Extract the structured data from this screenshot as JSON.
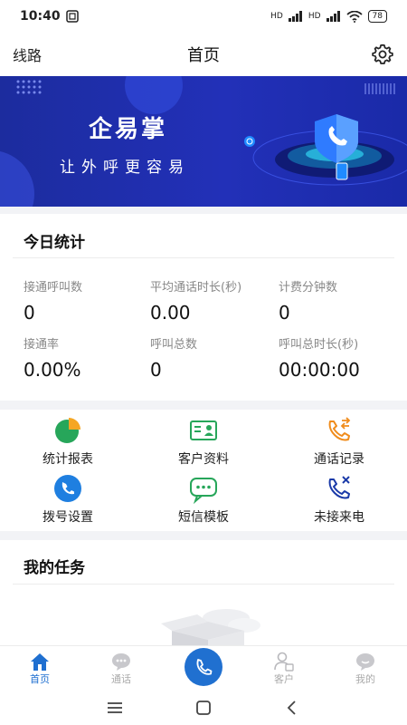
{
  "status_bar": {
    "time": "10:40",
    "network1": "HD",
    "network2": "HD",
    "battery": "78"
  },
  "header": {
    "left_label": "线路",
    "title": "首页",
    "settings_icon": "gear-icon"
  },
  "banner": {
    "title": "企易掌",
    "subtitle": "让外呼更容易"
  },
  "stats": {
    "title": "今日统计",
    "items": [
      {
        "label": "接通呼叫数",
        "value": "0"
      },
      {
        "label": "平均通话时长(秒)",
        "value": "0.00"
      },
      {
        "label": "计费分钟数",
        "value": "0"
      },
      {
        "label": "接通率",
        "value": "0.00%"
      },
      {
        "label": "呼叫总数",
        "value": "0"
      },
      {
        "label": "呼叫总时长(秒)",
        "value": "00:00:00"
      }
    ]
  },
  "menu": {
    "items": [
      {
        "label": "统计报表",
        "icon": "pie-chart-icon"
      },
      {
        "label": "客户资料",
        "icon": "contact-card-icon"
      },
      {
        "label": "通话记录",
        "icon": "call-log-icon"
      },
      {
        "label": "拨号设置",
        "icon": "dial-settings-icon"
      },
      {
        "label": "短信模板",
        "icon": "sms-template-icon"
      },
      {
        "label": "未接来电",
        "icon": "missed-call-icon"
      }
    ]
  },
  "tasks": {
    "title": "我的任务"
  },
  "tabbar": {
    "items": [
      {
        "label": "首页",
        "icon": "home-icon",
        "active": true
      },
      {
        "label": "通话",
        "icon": "chat-icon"
      },
      {
        "label": "",
        "icon": "phone-icon"
      },
      {
        "label": "客户",
        "icon": "person-icon"
      },
      {
        "label": "我的",
        "icon": "profile-icon"
      }
    ]
  },
  "colors": {
    "primary": "#2070d0",
    "banner_bg": "#2230b8",
    "pie_green": "#27a65a",
    "pie_orange": "#f5a623"
  }
}
